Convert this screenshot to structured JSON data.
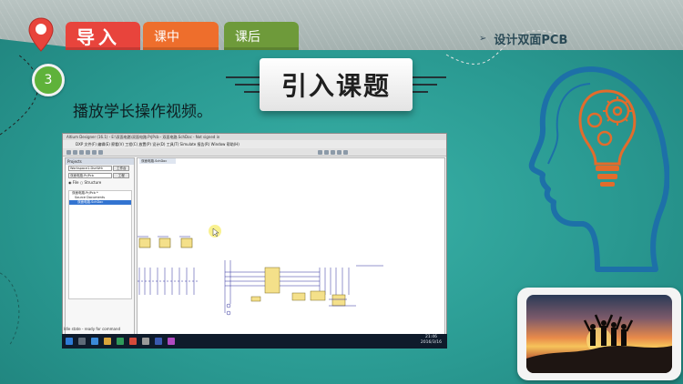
{
  "nav": {
    "tab_intro": "导入",
    "tab_during": "课中",
    "tab_after": "课后",
    "course_arrow": "➢",
    "course_title": "设计双面PCB"
  },
  "section": {
    "number": "3",
    "heading": "引入课题",
    "instruction": "播放学长操作视频。"
  },
  "screenshot": {
    "window_title": "Altium Designer (16.1) - E:\\双面电路\\双面电路.PrjPcb - 双面电路.SchDoc - Not signed in",
    "menu": "DXP  文件(F)  编辑(E)  察看(V)  工程(C)  放置(P)  设计(D)  工具(T)  Simulate  报告(R)  Window  帮助(H)",
    "panel_title": "Projects",
    "workspace_value": "Workspace1.DsnWrk",
    "workspace_button": "工作台",
    "project_value": "双面电路.PrjPcb",
    "project_button": "工程",
    "file_label": "File",
    "structure_label": "Structure",
    "tree_items": [
      "双面电路.PrjPcb *",
      "Source Documents",
      "双面电路.SchDoc"
    ],
    "left_tabs": "Files  Projects  Navigator  SCH Filter",
    "doc_tab": "双面电路.SchDoc",
    "editor_tab": "Editor",
    "status_left": "X:4480 Y:6350   Grid:5",
    "status_right": "System  Design Compiler  SCH  Instruments  OpenBus调色板  快捷键",
    "hint": "Idle state - ready for command",
    "clock_time": "21:46",
    "clock_date": "2016/3/16"
  },
  "colors": {
    "tab_intro": "#e8443c",
    "tab_during": "#ee6e2c",
    "tab_after": "#6e9a3a",
    "number_circle": "#5fb23a",
    "head_outline": "#1d70a8",
    "bulb_orange": "#e26c2c"
  },
  "icons": [
    "location-pin-icon",
    "head-bulb-gear-icon",
    "cursor-icon"
  ]
}
